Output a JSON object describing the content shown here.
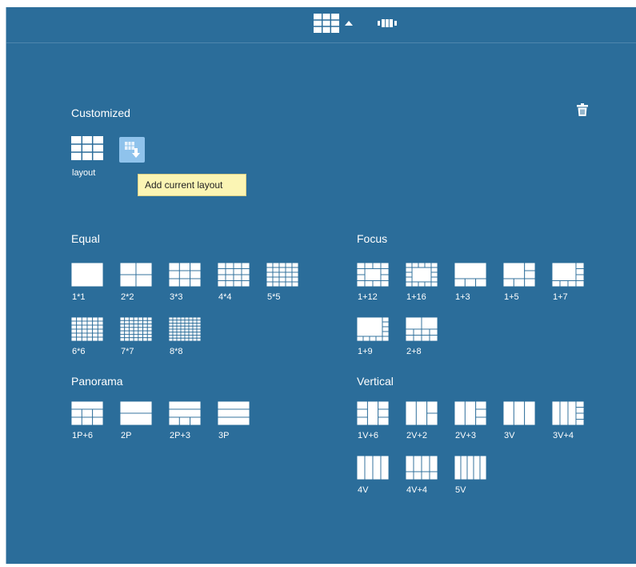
{
  "toolbar": {
    "layout_icon": "grid-layout-icon",
    "dropdown_icon": "caret-up-icon",
    "patrol_icon": "film-patrol-icon"
  },
  "customized": {
    "title": "Customized",
    "delete_icon": "trash-icon",
    "saved": [
      {
        "label": "layout"
      }
    ],
    "add_icon": "add-layout-icon",
    "tooltip": "Add current layout"
  },
  "equal": {
    "title": "Equal",
    "items": [
      {
        "label": "1*1"
      },
      {
        "label": "2*2"
      },
      {
        "label": "3*3"
      },
      {
        "label": "4*4"
      },
      {
        "label": "5*5"
      },
      {
        "label": "6*6"
      },
      {
        "label": "7*7"
      },
      {
        "label": "8*8"
      }
    ]
  },
  "focus": {
    "title": "Focus",
    "items": [
      {
        "label": "1+12"
      },
      {
        "label": "1+16"
      },
      {
        "label": "1+3"
      },
      {
        "label": "1+5"
      },
      {
        "label": "1+7"
      },
      {
        "label": "1+9"
      },
      {
        "label": "2+8"
      }
    ]
  },
  "panorama": {
    "title": "Panorama",
    "items": [
      {
        "label": "1P+6"
      },
      {
        "label": "2P"
      },
      {
        "label": "2P+3"
      },
      {
        "label": "3P"
      }
    ]
  },
  "vertical": {
    "title": "Vertical",
    "items": [
      {
        "label": "1V+6"
      },
      {
        "label": "2V+2"
      },
      {
        "label": "2V+3"
      },
      {
        "label": "3V"
      },
      {
        "label": "3V+4"
      },
      {
        "label": "4V"
      },
      {
        "label": "4V+4"
      },
      {
        "label": "5V"
      }
    ]
  }
}
